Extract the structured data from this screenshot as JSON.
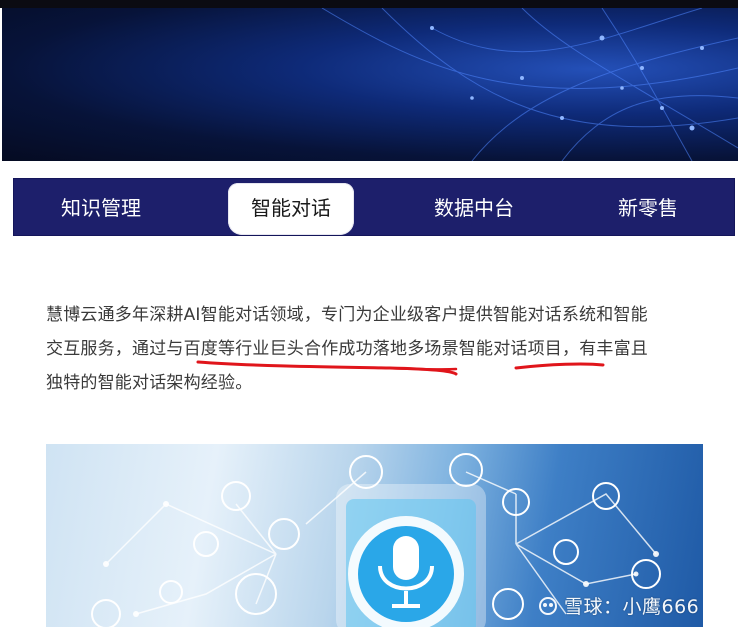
{
  "tabs": [
    {
      "label": "知识管理",
      "active": false
    },
    {
      "label": "智能对话",
      "active": true
    },
    {
      "label": "数据中台",
      "active": false
    },
    {
      "label": "新零售",
      "active": false
    }
  ],
  "article": {
    "line1": "慧博云通多年深耕AI智能对话领域，专门为企业级客户提供智能对话系统和智能",
    "line2": "交互服务，通过与百度等行业巨头合作成功落地多场景智能对话项目，有丰富且",
    "line3": "独特的智能对话架构经验。"
  },
  "watermark": {
    "text": "雪球：小鹰666"
  },
  "colors": {
    "tabbar": "#1d1f6b",
    "underline": "#e0151b",
    "text": "#3a3a3a"
  },
  "icons": [
    "microphone-icon",
    "mail-icon",
    "phone-icon",
    "headphones-icon",
    "camera-icon",
    "watch-icon",
    "cloud-upload-icon",
    "mouse-icon",
    "send-icon"
  ]
}
